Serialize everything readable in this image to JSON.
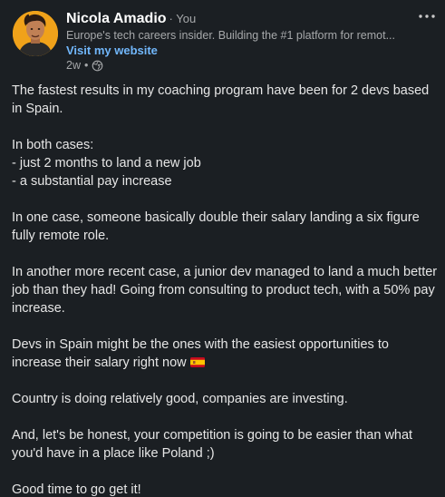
{
  "post": {
    "author": {
      "name": "Nicola Amadio",
      "badge": "· You",
      "headline": "Europe's tech careers insider. Building the #1 platform for remot...",
      "website_label": "Visit my website",
      "timestamp": "2w",
      "separator": "•",
      "visibility_icon": "globe-icon",
      "avatar_color": "#f0a21a"
    },
    "menu_icon": "more-dots-icon",
    "paragraphs": [
      [
        "The fastest results in my coaching program have been for 2 devs based in Spain."
      ],
      [
        "In both cases:",
        "- just 2 months to land a new job",
        "- a substantial pay increase"
      ],
      [
        "In one case, someone basically double their salary landing a six figure fully remote role."
      ],
      [
        "In another more recent case, a junior dev managed to land a much better job than they had! Going from consulting to product tech, with a 50% pay increase."
      ],
      [
        "Devs in Spain might be the ones with the easiest opportunities to increase their salary right now"
      ],
      [
        "Country is doing relatively good, companies are investing."
      ],
      [
        "And, let's be honest, your competition is going to be easier than what you'd have in a place like Poland ;)"
      ],
      [
        "Good time to go get it!"
      ]
    ],
    "flag_icon": "spain-flag-icon",
    "colors": {
      "background": "#1b1f23",
      "text": "#e6e6e6",
      "muted": "#a6a8aa",
      "link": "#71b7fb"
    }
  }
}
